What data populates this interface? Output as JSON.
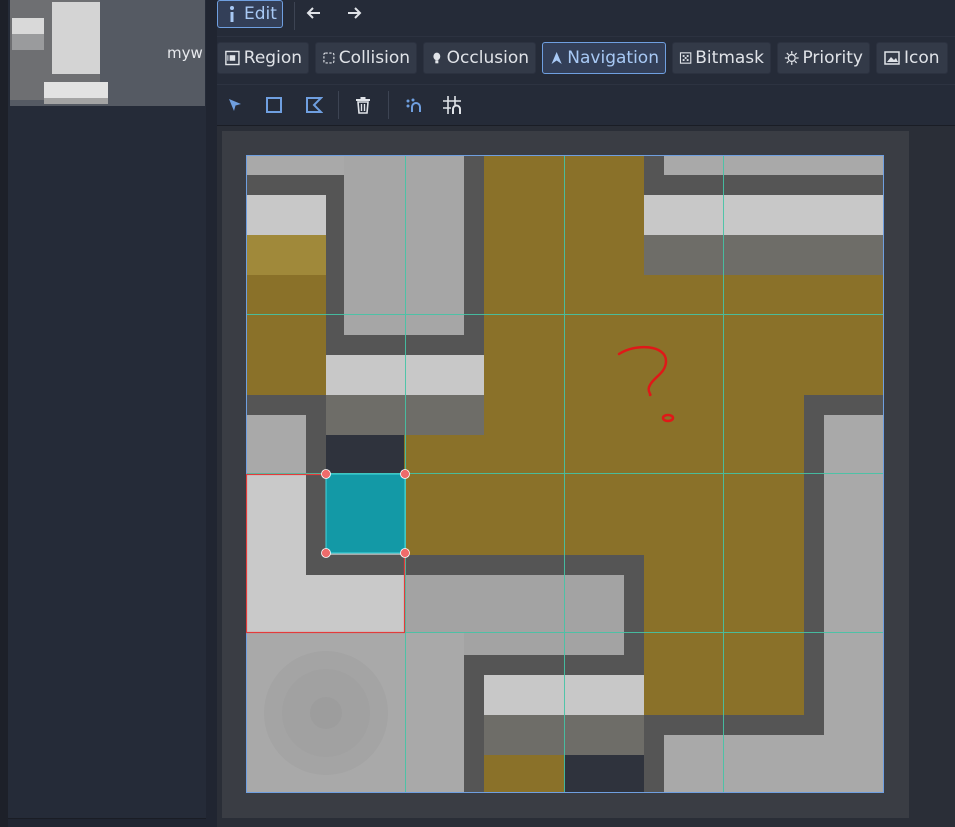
{
  "sidebar": {
    "thumbnail_label": "myw",
    "thumbnail_icon": "tileset-thumbnail"
  },
  "toolbar": {
    "edit_label": "Edit",
    "back_icon": "arrow-left-icon",
    "forward_icon": "arrow-right-icon"
  },
  "mode_tabs": {
    "region": "Region",
    "collision": "Collision",
    "occlusion": "Occlusion",
    "navigation": "Navigation",
    "bitmask": "Bitmask",
    "priority": "Priority",
    "icon": "Icon",
    "active": "Navigation"
  },
  "tools": {
    "select": "select-pointer-icon",
    "rect": "rectangle-icon",
    "polygon": "polygon-icon",
    "delete": "trash-icon",
    "snap": "snap-icon",
    "grid": "grid-snap-icon"
  },
  "colors": {
    "accent": "#6f9fe0",
    "navigation_polygon": "#1399a6",
    "handle": "#ee6b6b",
    "grid_line": "#45c4a6",
    "selection_border": "#e33b3b",
    "annotation": "#e01818"
  },
  "canvas": {
    "annotation_text": "?"
  }
}
